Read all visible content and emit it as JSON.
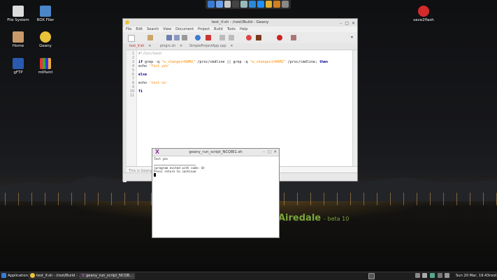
{
  "desktop": {
    "icons": [
      {
        "label": "File System"
      },
      {
        "label": "ROX Filer"
      },
      {
        "label": "Home"
      },
      {
        "label": "Geany"
      },
      {
        "label": "gFTP"
      },
      {
        "label": "mtPaint"
      },
      {
        "label": "save2flash"
      }
    ],
    "brand": {
      "name": "Airedale",
      "version": "- beta 10"
    }
  },
  "geany": {
    "title": "test_if.sh - /root/Build - Geany",
    "menu": [
      "File",
      "Edit",
      "Search",
      "View",
      "Document",
      "Project",
      "Build",
      "Tools",
      "Help"
    ],
    "tabs": [
      {
        "label": "test_if.sh",
        "active": true
      },
      {
        "label": "pingrc.sh",
        "active": false
      },
      {
        "label": "SimpleProjectApp.cpp",
        "active": false
      }
    ],
    "lines": [
      {
        "n": "1",
        "text": "#!/bin/bash"
      },
      {
        "n": "2",
        "text": ""
      },
      {
        "n": "3",
        "text": "if grep -q \"w_changes=RAM2\" /proc/cmdline || grep -q \"w_changes1=RAM2\" /proc/cmdline; then"
      },
      {
        "n": "4",
        "text": "echo 'Test yes'"
      },
      {
        "n": "5",
        "text": ""
      },
      {
        "n": "6",
        "text": "else"
      },
      {
        "n": "7",
        "text": ""
      },
      {
        "n": "8",
        "text": "echo 'test no'"
      },
      {
        "n": "9",
        "text": ""
      },
      {
        "n": "10",
        "text": "fi"
      },
      {
        "n": "11",
        "text": ""
      }
    ],
    "message": "This is Geany"
  },
  "terminal": {
    "title": "geany_run_script_NCQBI1.sh",
    "output_line": "Test yes",
    "exit_line": "(program exited with code: 0)",
    "prompt_line": "Press return to continue"
  },
  "taskbar": {
    "apps_label": "Applications",
    "task1": "test_if.sh - /root/Build - ...",
    "task2": "geany_run_script_NCQB...",
    "clock": "Sun 20 Mar, 19:43",
    "user": "root"
  }
}
